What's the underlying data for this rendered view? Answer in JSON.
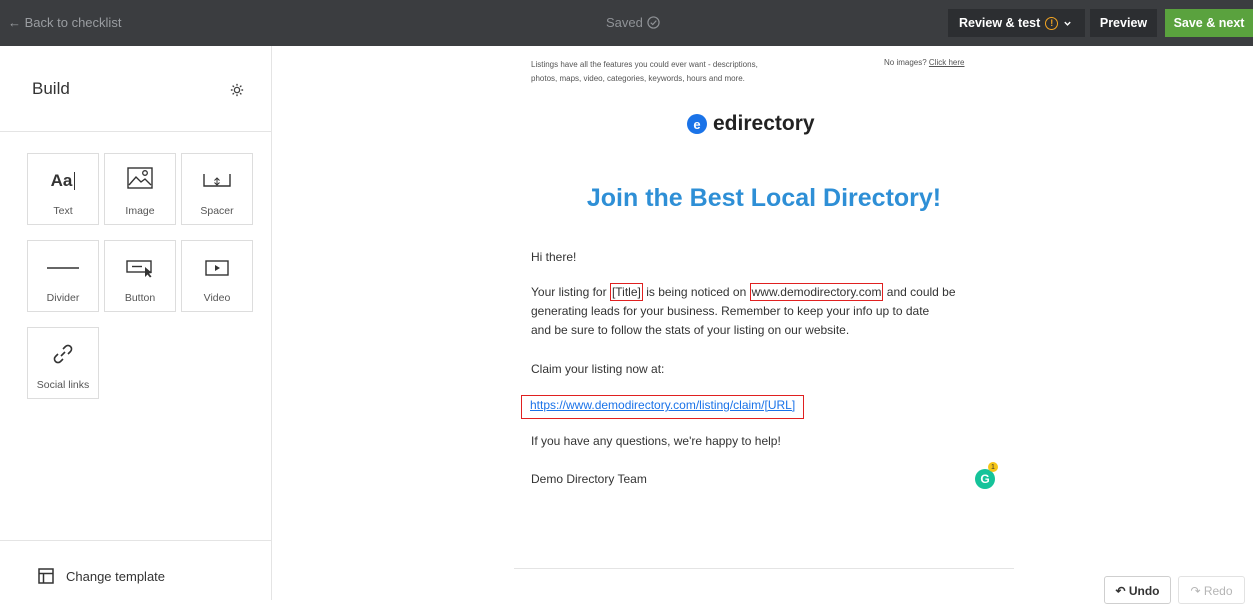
{
  "topbar": {
    "back_label": "← Back to checklist",
    "saved_label": "Saved",
    "review_label": "Review & test",
    "preview_label": "Preview",
    "save_next_label": "Save & next"
  },
  "sidebar": {
    "title": "Build",
    "blocks": [
      {
        "label": "Text",
        "icon": "text-icon"
      },
      {
        "label": "Image",
        "icon": "image-icon"
      },
      {
        "label": "Spacer",
        "icon": "spacer-icon"
      },
      {
        "label": "Divider",
        "icon": "divider-icon"
      },
      {
        "label": "Button",
        "icon": "button-icon"
      },
      {
        "label": "Video",
        "icon": "video-icon"
      },
      {
        "label": "Social links",
        "icon": "link-icon"
      }
    ],
    "text_icon_glyph": "Aa",
    "change_template_label": "Change template"
  },
  "email": {
    "intro": "Listings have all the features you could ever want - descriptions, photos, maps, video, categories, keywords, hours and more.",
    "no_images_label": "No images?",
    "click_here_label": "Click here",
    "logo_letter": "e",
    "logo_text": "edirectory",
    "headline": "Join the Best Local Directory!",
    "greeting": "Hi there!",
    "body_part1": "Your listing for",
    "body_title_token": "[Title]",
    "body_part2": "is being noticed on",
    "body_site": "www.demodirectory.com",
    "body_part3": "and could be",
    "body_line2": "generating leads for your business. Remember to keep your info up to date",
    "body_line3": "and be sure to follow the stats of your listing on our website.",
    "claim_label": "Claim your listing now at:",
    "claim_url": "https://www.demodirectory.com/listing/claim/[URL]",
    "questions": "If you have any questions, we're happy to help!",
    "signature": "Demo Directory Team"
  },
  "grammarly": {
    "letter": "G",
    "count": "1"
  },
  "history": {
    "undo_label": "↶ Undo",
    "redo_label": "↷ Redo"
  },
  "colors": {
    "topbar_bg": "#3b3d40",
    "accent_green": "#5aa23e",
    "headline_blue": "#2e8fd6",
    "highlight_red": "#e02020",
    "warning_orange": "#f5a623"
  }
}
